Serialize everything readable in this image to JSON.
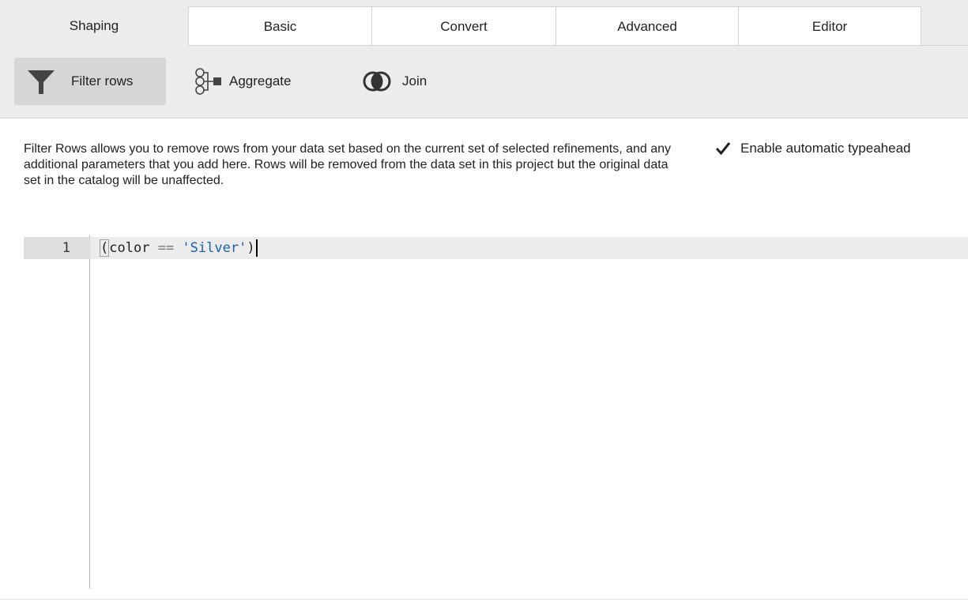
{
  "tabs": [
    {
      "label": "Shaping",
      "active": true
    },
    {
      "label": "Basic",
      "active": false
    },
    {
      "label": "Convert",
      "active": false
    },
    {
      "label": "Advanced",
      "active": false
    },
    {
      "label": "Editor",
      "active": false
    }
  ],
  "toolbar": {
    "filter_rows": {
      "label": "Filter rows",
      "icon": "funnel-icon",
      "active": true
    },
    "aggregate": {
      "label": "Aggregate",
      "icon": "aggregate-icon"
    },
    "join": {
      "label": "Join",
      "icon": "join-icon"
    }
  },
  "description": "Filter Rows allows you to remove rows from your data set based on the current set of selected refinements, and any additional parameters that you add here. Rows will be removed from the data set in this project but the original data set in the catalog will be unaffected.",
  "typeahead": {
    "label": "Enable automatic typeahead",
    "checked": true
  },
  "editor": {
    "line_number": "1",
    "code": {
      "paren_open": "(",
      "identifier": "color",
      "operator": "==",
      "string": "'Silver'",
      "paren_close": ")"
    }
  },
  "colors": {
    "string": "#1a5fb4",
    "panel_bg": "#ececec",
    "active_button_bg": "#d6d6d6"
  }
}
